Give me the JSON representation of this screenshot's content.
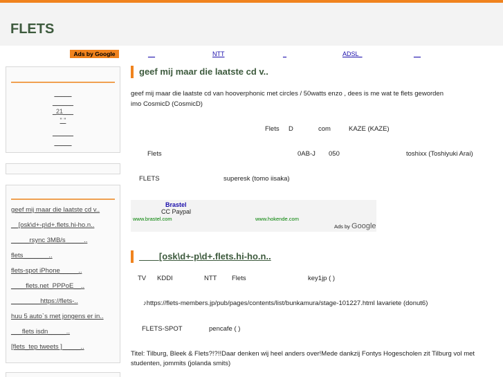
{
  "site": {
    "title": "FLETS"
  },
  "adbar": {
    "label": "Ads by Google",
    "links": [
      "__",
      "NTT",
      "_",
      "ADSL_",
      "__"
    ]
  },
  "sidebar_top": {
    "links": [
      "_____",
      "______",
      "_21___",
      "\" \"",
      "______",
      "_____"
    ]
  },
  "sidebar_posts": {
    "links": [
      "geef mij maar die laatste cd v..",
      "__[osk\\d+-p\\d+.flets.hi-ho.n..",
      "_____rsync 3MB/s_____..",
      "flets_______..",
      "flets-spot iPhone_____..",
      "____flets.net_PPPoE__..",
      "________https://flets-..",
      "huu 5 auto`s met jongens er in..",
      "___flets isdn_____..",
      "[flets_tep tweets ]_____.."
    ]
  },
  "post1": {
    "title": "geef mij maar die laatste cd v..",
    "line1": "geef mij maar die laatste cd van hooverphonic met circles / 50watts enzo , dees is me wat te flets geworden",
    "line2": "imo CosmicD (CosmicD)",
    "r1a": "Flets",
    "r1b": "D",
    "r1c": "com",
    "r1d": "KAZE (KAZE)",
    "r2a": "Flets",
    "r2b": "0AB-J",
    "r2c": "050",
    "r2d": "toshixx (Toshiyuki Arai)",
    "r3a": "FLETS",
    "r3b": "superesk (tomo iisaka)"
  },
  "ad": {
    "title": "Brastel",
    "desc": "CC Paypal",
    "url1": "www.brastel.com",
    "url2": "www.hokende.com",
    "by_prefix": "Ads by",
    "by_brand": "Google"
  },
  "post2": {
    "title": "____[osk\\d+-p\\d+.flets.hi-ho.n..",
    "r1a": "TV",
    "r1b": "KDDI",
    "r1c": "NTT",
    "r1d": "Flets",
    "r1e": "key1jp (    )",
    "r2": "♪https://flets-members.jp/pub/pages/contents/list/bunkamura/stage-101227.html lavariete (donut6)",
    "r3a": "FLETS-SPOT",
    "r3b": "pencafe (    )",
    "r4a": "Titel: Tilburg, Bleek & Flets?!?!!Daar denken wij heel anders over!Mede dankzij Fontys Hogescholen zit Tilburg vol met",
    "r4b": "studenten, jommits (jolanda smits)"
  },
  "colors": {
    "accent": "#f0831e",
    "title_green": "#3d5a3d",
    "link_blue": "#1a0dab"
  }
}
